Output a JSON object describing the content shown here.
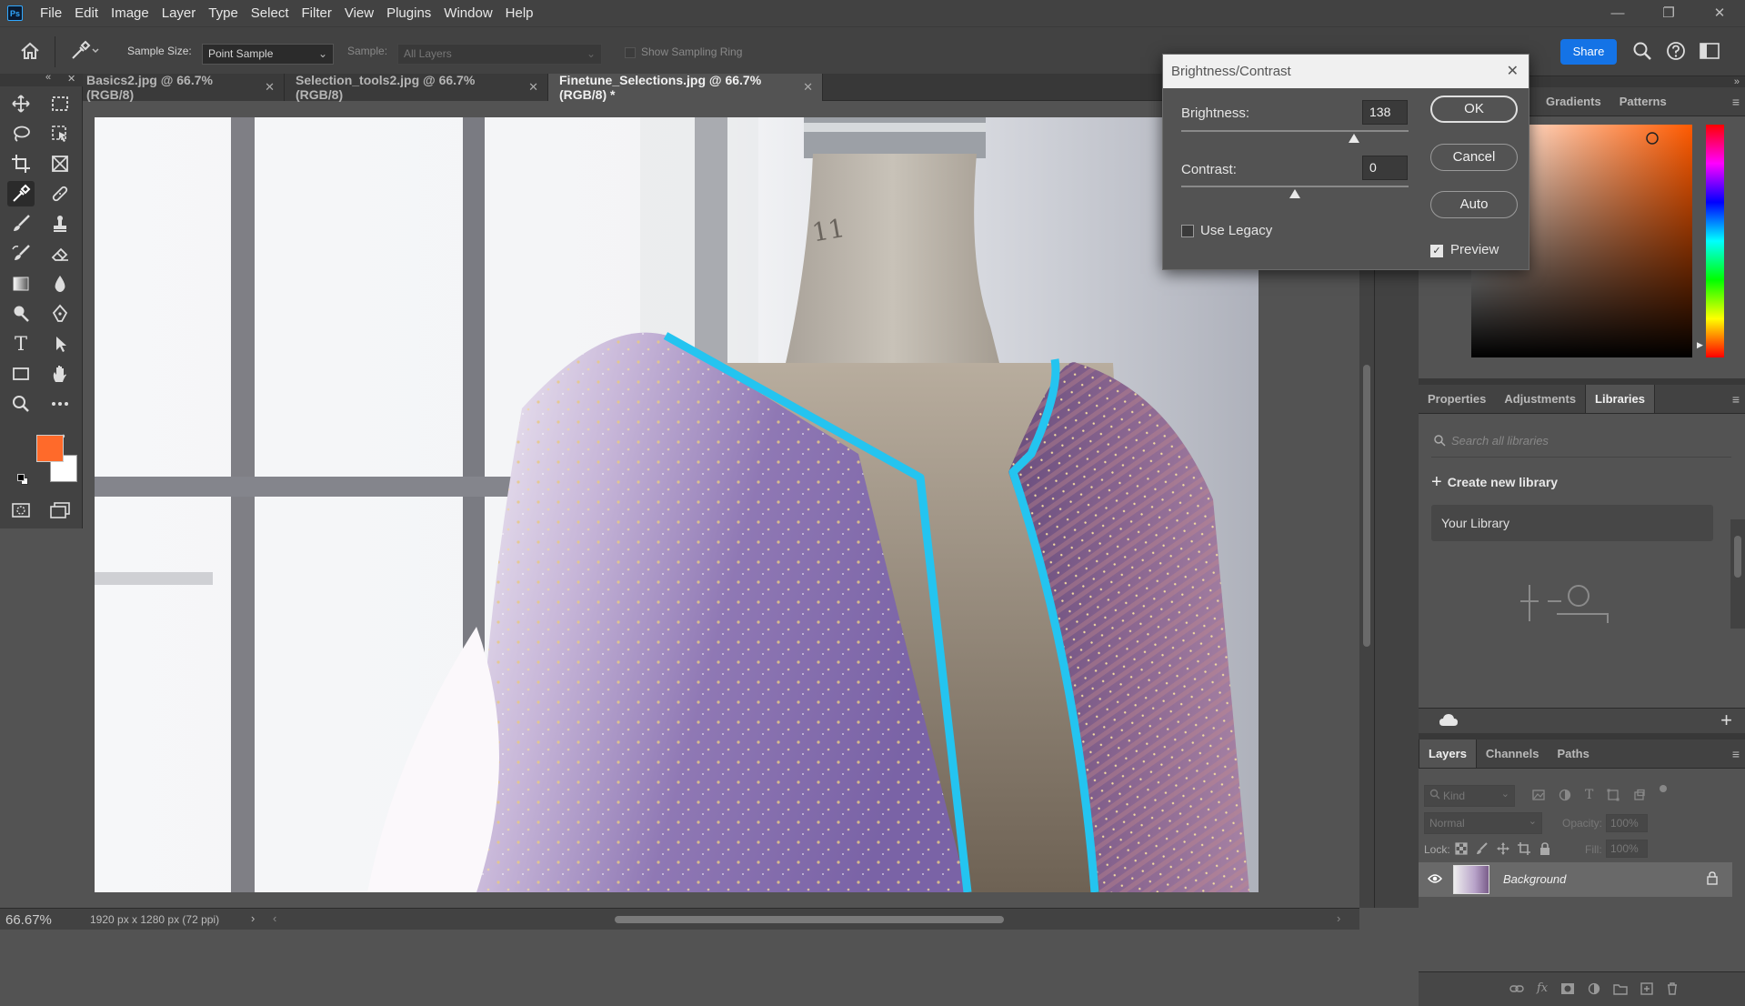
{
  "app": {
    "logo": "Ps"
  },
  "menu": [
    "File",
    "Edit",
    "Image",
    "Layer",
    "Type",
    "Select",
    "Filter",
    "View",
    "Plugins",
    "Window",
    "Help"
  ],
  "window_controls": {
    "minimize": "—",
    "restore": "❐",
    "close": "✕"
  },
  "options_bar": {
    "sample_size_label": "Sample Size:",
    "sample_size_value": "Point Sample",
    "sample_label": "Sample:",
    "sample_value": "All Layers",
    "sampling_ring_label": "Show Sampling Ring",
    "share_label": "Share"
  },
  "tabs": [
    {
      "label": "Basics2.jpg @ 66.7% (RGB/8)",
      "active": false
    },
    {
      "label": "Selection_tools2.jpg @ 66.7% (RGB/8)",
      "active": false
    },
    {
      "label": "Finetune_Selections.jpg @ 66.7% (RGB/8) *",
      "active": true
    }
  ],
  "tab_close": "✕",
  "colors": {
    "foreground": "#ff6a2a",
    "background": "#ffffff",
    "accent": "#1473e6",
    "selection": "#24c4f0"
  },
  "status": {
    "zoom": "66.67%",
    "doc_info": "1920 px x 1280 px (72 ppi)"
  },
  "dialog": {
    "title": "Brightness/Contrast",
    "brightness_label": "Brightness:",
    "brightness_value": "138",
    "brightness_level": 0.76,
    "contrast_label": "Contrast:",
    "contrast_value": "0",
    "contrast_level": 0.5,
    "use_legacy_label": "Use Legacy",
    "use_legacy_checked": false,
    "preview_label": "Preview",
    "preview_checked": true,
    "ok_label": "OK",
    "cancel_label": "Cancel",
    "auto_label": "Auto"
  },
  "color_panel": {
    "tabs": [
      "Gradients",
      "Patterns"
    ]
  },
  "libraries_panel": {
    "tabs": [
      "Properties",
      "Adjustments",
      "Libraries"
    ],
    "active_tab": "Libraries",
    "search_placeholder": "Search all libraries",
    "create_label": "Create new library",
    "library_item": "Your Library"
  },
  "layers_panel": {
    "tabs": [
      "Layers",
      "Channels",
      "Paths"
    ],
    "active_tab": "Layers",
    "filter_kind": "Kind",
    "blend_mode": "Normal",
    "opacity_label": "Opacity:",
    "opacity_value": "100%",
    "lock_label": "Lock:",
    "fill_label": "Fill:",
    "fill_value": "100%",
    "layer_name": "Background"
  }
}
